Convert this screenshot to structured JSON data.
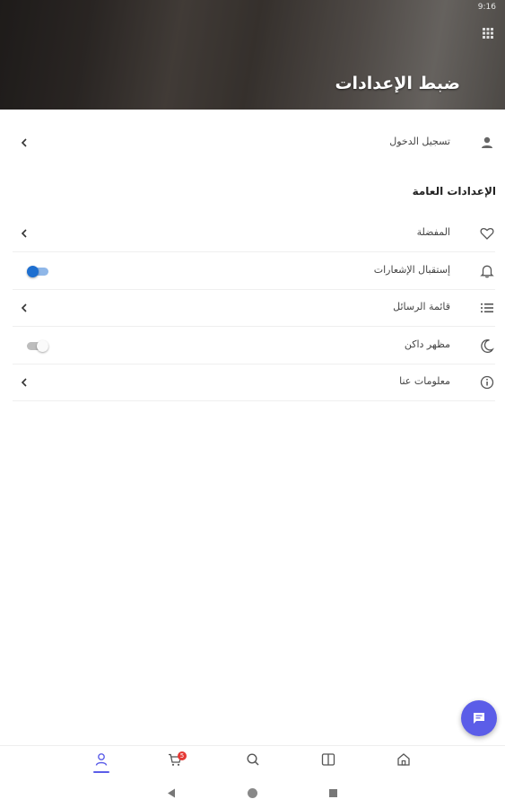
{
  "status_bar": {
    "time": "9:16"
  },
  "header": {
    "title": "ضبط الإعدادات",
    "image_desc_icon": "grid-icon"
  },
  "login_row": {
    "label": "تسجيل الدخول",
    "icon": "person-icon"
  },
  "general_section": {
    "title": "الإعدادات العامة"
  },
  "settings": [
    {
      "label": "المفضلة",
      "icon": "heart-icon",
      "control": "chevron"
    },
    {
      "label": "إستقبال الإشعارات",
      "icon": "bell-icon",
      "control": "toggle",
      "enabled": true
    },
    {
      "label": "قائمة الرسائل",
      "icon": "list-icon",
      "control": "chevron"
    },
    {
      "label": "مظهر داكن",
      "icon": "moon-icon",
      "control": "toggle",
      "enabled": false
    },
    {
      "label": "معلومات عنا",
      "icon": "info-icon",
      "control": "chevron"
    }
  ],
  "bottom_nav": {
    "items": [
      "profile-icon",
      "cart-icon",
      "search-icon",
      "book-icon",
      "home-icon"
    ],
    "active": "profile-icon",
    "cart_badge": "5"
  },
  "colors": {
    "accent": "#5b5de8",
    "toggle_on": "#1e6fd0",
    "badge": "#e53935"
  }
}
